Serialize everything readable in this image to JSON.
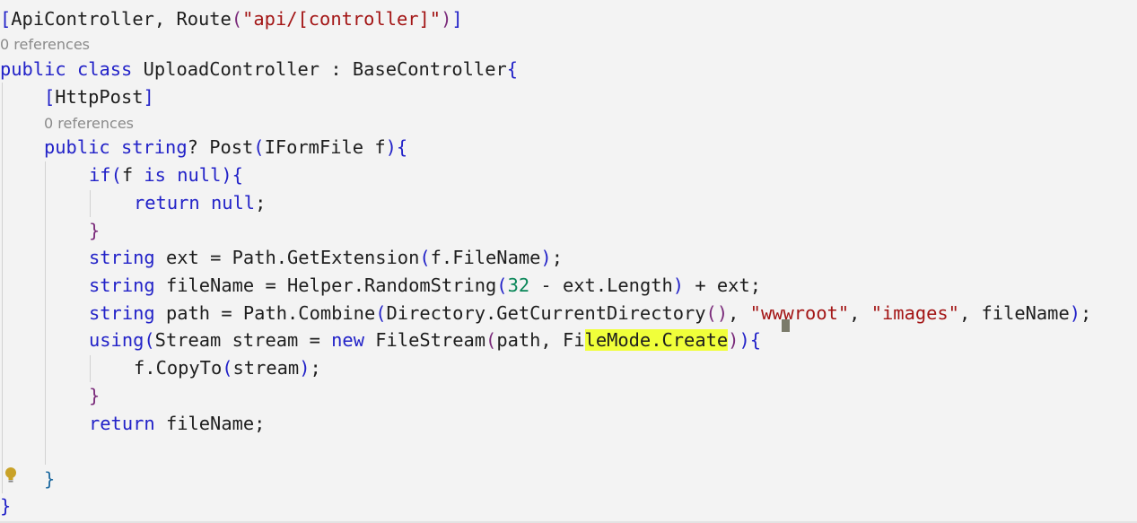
{
  "editor": {
    "line_attribute_class": "[ApiController, Route(\"api/[controller]\")]",
    "codelens_class": "0 references",
    "line_class_decl": "public class UploadController : BaseController{",
    "line_attribute_method": "[HttpPost]",
    "codelens_method": "0 references",
    "line_method_decl": "public string? Post(IFormFile f){",
    "line_if": "if(f is null){",
    "line_return_null": "return null;",
    "line_if_close": "}",
    "line_ext": "string ext = Path.GetExtension(f.FileName);",
    "line_filename": "string fileName = Helper.RandomString(32 - ext.Length) + ext;",
    "line_path": "string path = Path.Combine(Directory.GetCurrentDirectory(), \"wwwroot\", \"images\", fileName);",
    "line_using": "using(Stream stream = new FileStream(path, FileMode.Create)){",
    "line_copy": "f.CopyTo(stream);",
    "line_using_close": "}",
    "line_return_filename": "return fileName;",
    "line_method_close": "}",
    "line_class_close": "}"
  },
  "colors": {
    "background": "#f3f3f3",
    "keyword": "#2222c8",
    "string": "#a31515",
    "number": "#098658",
    "highlight": "#f0ff3a",
    "codelens": "#8a8a8a"
  },
  "icons": {
    "gutter": "lightbulb-icon"
  }
}
